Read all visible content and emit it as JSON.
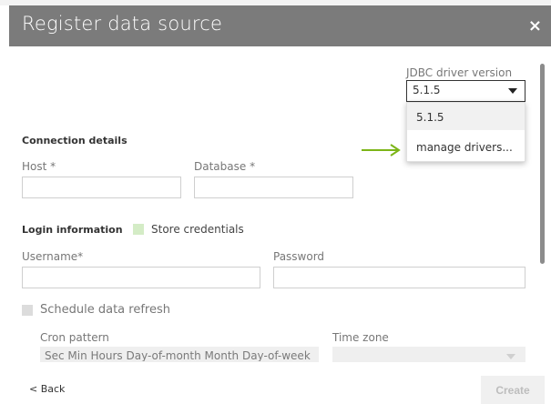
{
  "dialog": {
    "title": "Register data source",
    "close_glyph": "×"
  },
  "driver": {
    "label": "JDBC driver version",
    "selected": "5.1.5",
    "options": [
      "5.1.5",
      "manage drivers..."
    ]
  },
  "connection": {
    "section_label": "Connection details",
    "host_label": "Host *",
    "database_label": "Database *"
  },
  "login": {
    "section_label": "Login information",
    "store_credentials_label": "Store credentials",
    "username_label": "Username*",
    "password_label": "Password"
  },
  "schedule": {
    "checkbox_label": "Schedule data refresh",
    "cron_label": "Cron pattern",
    "cron_placeholder": "Sec Min Hours Day-of-month Month Day-of-week",
    "timezone_label": "Time zone"
  },
  "footer": {
    "back_label": "< Back",
    "create_label": "Create"
  },
  "colors": {
    "header_bg": "#7b7b7b",
    "accent_arrow": "#7cb518",
    "store_credentials_checkbox": "#d4ecc6"
  }
}
